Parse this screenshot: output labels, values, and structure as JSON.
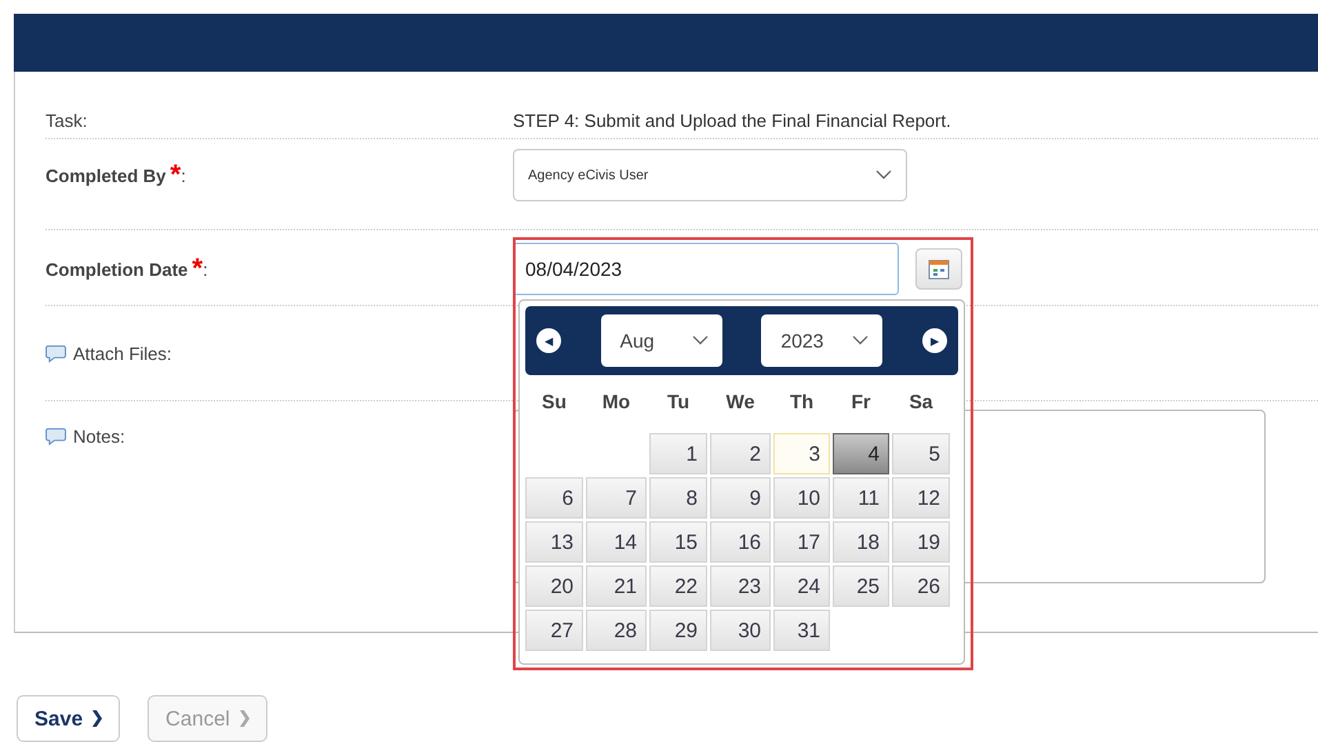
{
  "form": {
    "rows": [
      {
        "kind": "text",
        "label": "Task:",
        "required": false,
        "comment_icon": false,
        "value": "STEP 4: Submit and Upload the Final Financial Report."
      },
      {
        "kind": "select",
        "label": "Completed By",
        "required": true,
        "comment_icon": false,
        "value": "Agency eCivis User"
      },
      {
        "kind": "date",
        "label": "Completion Date",
        "required": true,
        "comment_icon": false,
        "value": "08/04/2023"
      },
      {
        "kind": "files",
        "label": "Attach Files:",
        "required": false,
        "comment_icon": true
      },
      {
        "kind": "notes",
        "label": "Notes:",
        "required": false,
        "comment_icon": true
      }
    ]
  },
  "required_mark": "*",
  "label_suffix": ":",
  "datepicker": {
    "prev": "◀",
    "next": "▶",
    "month": "Aug",
    "year": "2023",
    "weekdays": [
      "Su",
      "Mo",
      "Tu",
      "We",
      "Th",
      "Fr",
      "Sa"
    ],
    "days": [
      {
        "kind": "empty"
      },
      {
        "kind": "empty"
      },
      {
        "label": "1",
        "selected": false,
        "today": false
      },
      {
        "label": "2",
        "selected": false,
        "today": false
      },
      {
        "label": "3",
        "selected": false,
        "today": true
      },
      {
        "label": "4",
        "selected": true,
        "today": false
      },
      {
        "label": "5",
        "selected": false,
        "today": false
      },
      {
        "label": "6",
        "selected": false,
        "today": false
      },
      {
        "label": "7",
        "selected": false,
        "today": false
      },
      {
        "label": "8",
        "selected": false,
        "today": false
      },
      {
        "label": "9",
        "selected": false,
        "today": false
      },
      {
        "label": "10",
        "selected": false,
        "today": false
      },
      {
        "label": "11",
        "selected": false,
        "today": false
      },
      {
        "label": "12",
        "selected": false,
        "today": false
      },
      {
        "label": "13",
        "selected": false,
        "today": false
      },
      {
        "label": "14",
        "selected": false,
        "today": false
      },
      {
        "label": "15",
        "selected": false,
        "today": false
      },
      {
        "label": "16",
        "selected": false,
        "today": false
      },
      {
        "label": "17",
        "selected": false,
        "today": false
      },
      {
        "label": "18",
        "selected": false,
        "today": false
      },
      {
        "label": "19",
        "selected": false,
        "today": false
      },
      {
        "label": "20",
        "selected": false,
        "today": false
      },
      {
        "label": "21",
        "selected": false,
        "today": false
      },
      {
        "label": "22",
        "selected": false,
        "today": false
      },
      {
        "label": "23",
        "selected": false,
        "today": false
      },
      {
        "label": "24",
        "selected": false,
        "today": false
      },
      {
        "label": "25",
        "selected": false,
        "today": false
      },
      {
        "label": "26",
        "selected": false,
        "today": false
      },
      {
        "label": "27",
        "selected": false,
        "today": false
      },
      {
        "label": "28",
        "selected": false,
        "today": false
      },
      {
        "label": "29",
        "selected": false,
        "today": false
      },
      {
        "label": "30",
        "selected": false,
        "today": false
      },
      {
        "label": "31",
        "selected": false,
        "today": false
      }
    ]
  },
  "buttons": [
    {
      "label": "Save",
      "disabled": false
    },
    {
      "label": "Cancel",
      "disabled": true
    }
  ]
}
